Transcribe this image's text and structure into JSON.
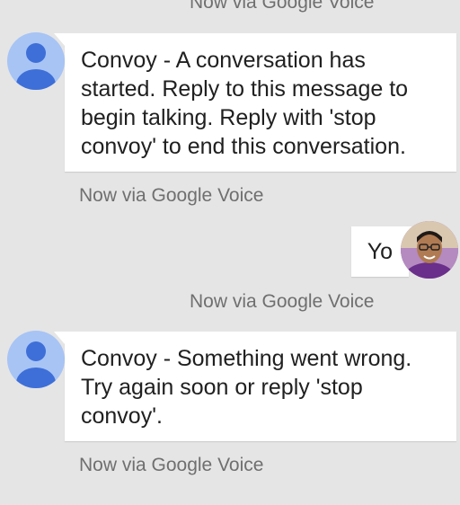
{
  "messages": [
    {
      "direction": "incoming",
      "text": "Convoy - A conversation has started. Reply to this message to begin talking. Reply with 'stop convoy' to end this conversation.",
      "avatar": "person-icon"
    },
    {
      "direction": "outgoing",
      "text": "Yo",
      "avatar": "user-photo"
    },
    {
      "direction": "incoming",
      "text": "Convoy - Something went wrong. Try again soon or reply 'stop convoy'.",
      "avatar": "person-icon"
    }
  ],
  "meta": {
    "top_partial": "Now via Google Voice",
    "after_first": "Now via Google Voice",
    "after_outgoing": "Now via Google Voice",
    "after_last": "Now via Google Voice"
  },
  "colors": {
    "background": "#e5e5e5",
    "bubble": "#ffffff",
    "generic_avatar_bg": "#a7c4f5",
    "generic_avatar_fg": "#3e6fd8",
    "meta_text": "#6f6f6f"
  }
}
